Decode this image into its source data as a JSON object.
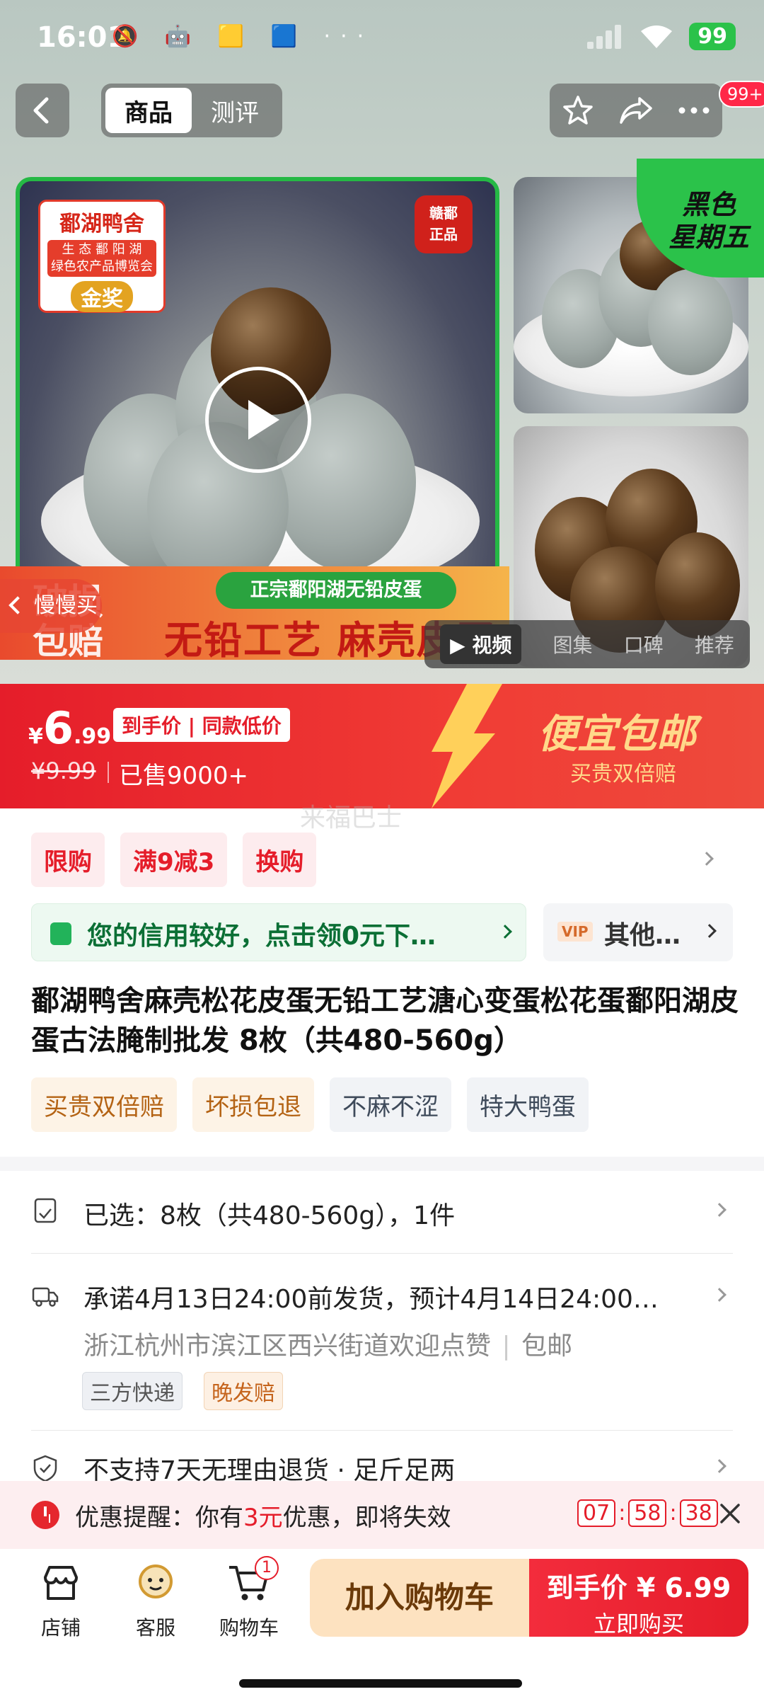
{
  "status_bar": {
    "time": "16:01",
    "left_icons": "🔕 🤖 🟨 🟦 ···",
    "battery": "99"
  },
  "top_nav": {
    "tabs": [
      {
        "label": "商品",
        "active": true
      },
      {
        "label": "测评",
        "active": false
      }
    ],
    "badge": "99+"
  },
  "gallery": {
    "brand_name": "鄱湖鸭舍",
    "brand_sub_line1": "生 态 鄱 阳 湖",
    "brand_sub_line2": "绿色农产品博览会",
    "brand_award": "金奖",
    "stamp_line1": "赣鄱",
    "stamp_line2": "正品",
    "banner_pill": "正宗鄱阳湖无铅皮蛋",
    "banner_big": "无铅工艺 麻壳皮蛋",
    "broken_label": "破损包赔",
    "slow_buy": "慢慢买",
    "black_friday_line1": "黑色",
    "black_friday_line2": "星期五",
    "media_tabs": [
      {
        "label": "视频",
        "active": true
      },
      {
        "label": "图集",
        "active": false
      },
      {
        "label": "口碑",
        "active": false
      },
      {
        "label": "推荐",
        "active": false
      }
    ]
  },
  "price": {
    "currency": "¥",
    "now_int": "6",
    "now_dec": ".99",
    "tag": "到手价 | 同款低价",
    "old": "¥9.99",
    "sold": "已售9000+",
    "promo_title": "便宜包邮",
    "promo_sub": "买贵双倍赔",
    "watermark": "来福巴士"
  },
  "promos": [
    "限购",
    "满9减3",
    "换购"
  ],
  "credit": {
    "text": "您的信用较好，点击领0元下…",
    "other_badge": "VIP",
    "other_text": "其他…"
  },
  "product": {
    "title": "鄱湖鸭舍麻壳松花皮蛋无铅工艺溏心变蛋松花蛋鄱阳湖皮蛋古法腌制批发 8枚（共480-560g）",
    "features_warm": [
      "买贵双倍赔",
      "坏损包退"
    ],
    "features_cool": [
      "不麻不涩",
      "特大鸭蛋"
    ]
  },
  "info": {
    "selected": "已选：8枚（共480-560g），1件",
    "shipping": "承诺4月13日24:00前发货，预计4月14日24:00…",
    "address": "浙江杭州市滨江区西兴街道欢迎点赞",
    "free_ship": "包邮",
    "ship_tags": [
      "三方快递",
      "晚发赔"
    ],
    "service": "不支持7天无理由退货 · 足斤足两"
  },
  "reminder": {
    "prefix": "优惠提醒：你有",
    "amount": "3元",
    "suffix": "优惠，即将失效",
    "hh": "07",
    "mm": "58",
    "ss": "38"
  },
  "bottom_bar": {
    "shop": "店铺",
    "service": "客服",
    "cart": "购物车",
    "cart_count": "1",
    "add_to_cart": "加入购物车",
    "buy_price": "到手价 ¥ 6.99",
    "buy_label": "立即购买"
  }
}
